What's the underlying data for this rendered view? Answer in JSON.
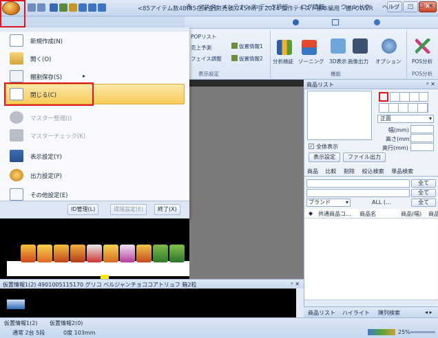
{
  "window": {
    "title": "<85アイテム数4B(85在庫金額(売価)24598円) 2014 操作テキスト基本編用 - 棚POWER",
    "minimize": "—",
    "maximize": "□",
    "close": "✕"
  },
  "ribbon": {
    "tabs": [
      "表",
      "マスターメンテナンス",
      "データ移行",
      "ログ情報",
      "ウィンドウ",
      "ヘルプ",
      "-",
      "☐",
      "✕"
    ],
    "left_items": [
      "POPリスト",
      "売上予測",
      "フェイス調整"
    ],
    "mid_items": [
      "仮置情報1",
      "仮置情報2"
    ],
    "group_display": "表示設定",
    "big_buttons": [
      "分析検証",
      "ゾーニング",
      "3D表示",
      "画像出力",
      "オプション",
      "POS分析"
    ],
    "group_function": "機能",
    "group_pos": "POS分析"
  },
  "appmenu": {
    "items": [
      {
        "label": "新規作成(N)",
        "disabled": false
      },
      {
        "label": "開く(O)",
        "disabled": false
      },
      {
        "label": "棚割保存(S)",
        "disabled": false,
        "arrow": "▸"
      },
      {
        "label": "閉じる(C)",
        "disabled": false
      },
      {
        "label": "マスター整理(I)",
        "disabled": true
      },
      {
        "label": "マスターチェック(K)",
        "disabled": true
      },
      {
        "label": "表示設定(Y)",
        "disabled": false
      },
      {
        "label": "出力設定(P)",
        "disabled": false
      },
      {
        "label": "その他設定(E)",
        "disabled": false
      }
    ],
    "footer": [
      "ID管理(L)",
      "環境設定(E)",
      "終了(X)"
    ]
  },
  "right_panel": {
    "title": "商品リスト",
    "pin": "ᵖ ✕",
    "view_select": "正面",
    "width_label": "幅(mm)",
    "height_label": "高さ(mm)",
    "depth_label": "奥行(mm)",
    "show_all_label": "全体表示",
    "display_settings_button": "表示設定",
    "file_output_button": "ファイル出力",
    "tabs": [
      "商品",
      "比較",
      "削除",
      "絞込検索",
      "単品検索"
    ],
    "all_label": "全て",
    "brand_select": "ブランド",
    "all_dots": "ALL (...",
    "columns": [
      "共通商品コ...",
      "商品名",
      "商品(幅)",
      "商品"
    ],
    "bottom_tabs": [
      "商品リスト",
      "ハイライト",
      "陳列検索"
    ],
    "nav": "◂ ▸"
  },
  "info_bar": {
    "text": "仮置情報1(2) 4901005115170 グリコ ベルジャンチョココアトリュフ 箱2粒",
    "pin": "ᵖ ✕"
  },
  "status": {
    "tabs": [
      "仮置情報1(2)",
      "仮置情報2(0)"
    ],
    "left": "通常 2台 5段",
    "angle": "0度 103mm",
    "zoom": "25%"
  },
  "colors": {
    "highlight_red": "#e0141b",
    "close_button": "#f8c958"
  }
}
